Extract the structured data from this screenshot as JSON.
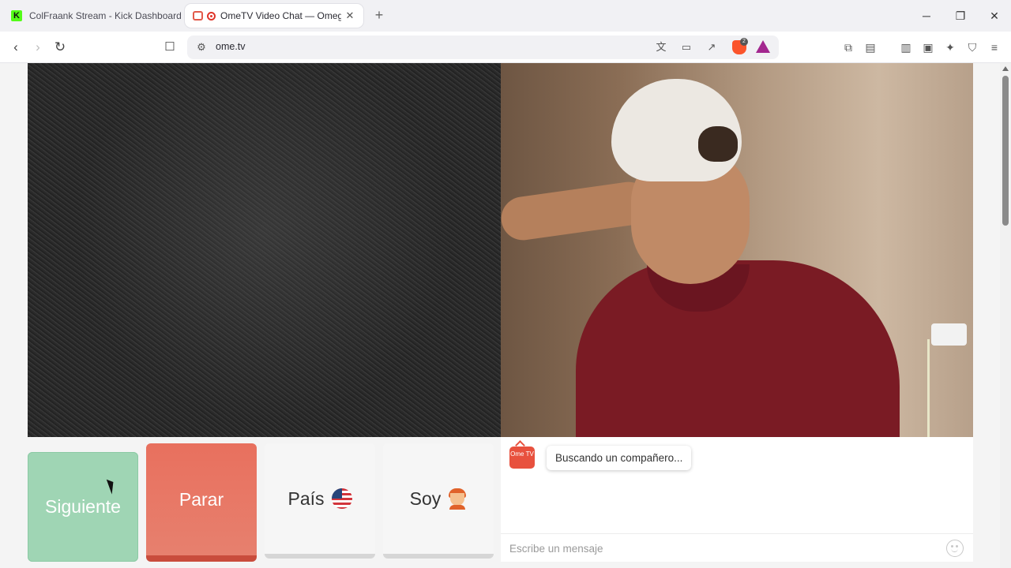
{
  "tabs": [
    {
      "title": "ColFraank Stream - Kick Dashboard",
      "favicon": "kick-icon",
      "active": false
    },
    {
      "title": "OmeTV Video Chat — Omegl",
      "favicon": "ometv-icon",
      "active": true
    }
  ],
  "window_controls": {
    "minimize": "─",
    "restore": "❐",
    "close": "✕"
  },
  "nav": {
    "url": "ome.tv"
  },
  "toolbar_icons": [
    "extensions-icon",
    "reading-list-icon",
    "sidebar-icon",
    "wallet-icon",
    "leo-ai-icon",
    "vpn-shield-icon",
    "menu-icon"
  ],
  "brave_shield_badge": "2",
  "controls": {
    "next_label": "Siguiente",
    "stop_label": "Parar",
    "country_label": "País",
    "gender_label": "Soy"
  },
  "chat": {
    "logo_text": "Ome TV",
    "status_message": "Buscando un compañero...",
    "input_placeholder": "Escribe un mensaje"
  },
  "colors": {
    "next_button": "#9fd5b4",
    "stop_button": "#e86b5a",
    "brand": "#e8513e"
  }
}
